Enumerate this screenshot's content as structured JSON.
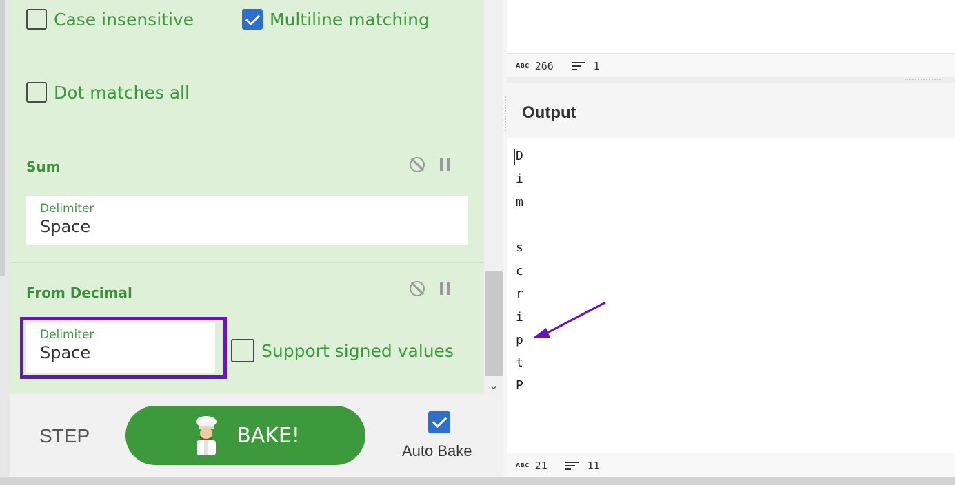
{
  "recipe": {
    "regex_options": {
      "case_insensitive": {
        "label": "Case insensitive",
        "checked": false
      },
      "multiline_matching": {
        "label": "Multiline matching",
        "checked": true
      },
      "dot_matches_all": {
        "label": "Dot matches all",
        "checked": false
      }
    },
    "operations": [
      {
        "title": "Sum",
        "icons": [
          "disable-icon",
          "pause-icon"
        ],
        "delimiter_label": "Delimiter",
        "delimiter_value": "Space"
      },
      {
        "title": "From Decimal",
        "icons": [
          "disable-icon",
          "pause-icon"
        ],
        "delimiter_label": "Delimiter",
        "delimiter_value": "Space",
        "support_signed": {
          "label": "Support signed values",
          "checked": false
        }
      }
    ],
    "highlight_color": "#6a13c2"
  },
  "controls": {
    "step_label": "STEP",
    "bake_label": "BAKE!",
    "bake_icon": "chef-icon",
    "auto_bake_label": "Auto Bake",
    "auto_bake_checked": true
  },
  "input_status": {
    "chars": "266",
    "lines": "1"
  },
  "output": {
    "title": "Output",
    "lines": [
      "D",
      "i",
      "m",
      "",
      "s",
      "c",
      "r",
      "i",
      "p",
      "t",
      "P"
    ],
    "status": {
      "chars": "21",
      "lines": "11"
    }
  },
  "colors": {
    "accent_green": "#3c9a3c",
    "recipe_bg": "#dff0d8",
    "checkbox_blue": "#2d6fd1",
    "annotation_purple": "#6a13c2"
  }
}
